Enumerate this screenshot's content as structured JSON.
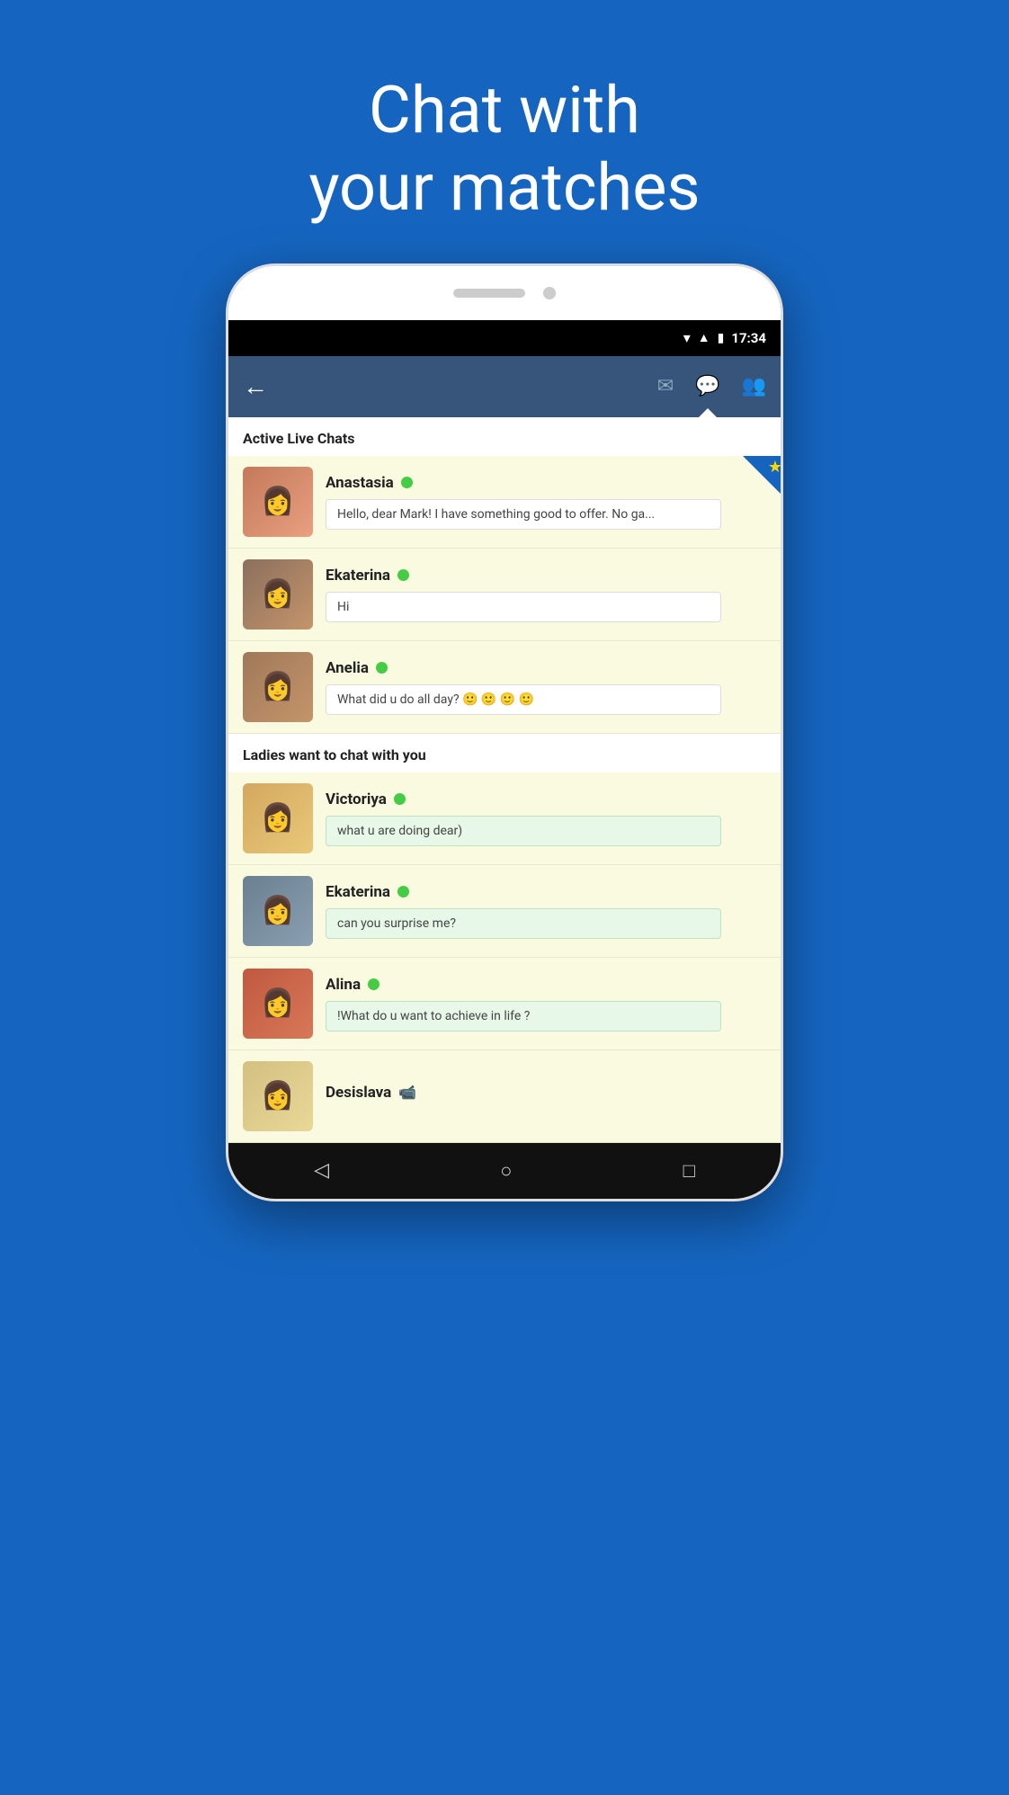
{
  "hero": {
    "line1": "Chat with",
    "line2": "your matches"
  },
  "statusBar": {
    "time": "17:34"
  },
  "header": {
    "backLabel": "←",
    "icons": [
      "mail",
      "chat-bubble",
      "people-list"
    ]
  },
  "activeLivechats": {
    "sectionLabel": "Active Live Chats",
    "items": [
      {
        "name": "Anastasia",
        "online": true,
        "message": "Hello, dear Mark! I have something good to offer. No ga...",
        "avatarClass": "av-anastasia",
        "hasStar": true,
        "mintBg": false
      },
      {
        "name": "Ekaterina",
        "online": true,
        "message": "Hi",
        "avatarClass": "av-ekaterina1",
        "hasStar": false,
        "mintBg": false
      },
      {
        "name": "Anelia",
        "online": true,
        "message": "What did u do all day? 🙂 🙂 🙂 🙂",
        "avatarClass": "av-anelia",
        "hasStar": false,
        "mintBg": false
      }
    ]
  },
  "ladiesSection": {
    "sectionLabel": "Ladies want to chat with you",
    "items": [
      {
        "name": "Victoriya",
        "online": true,
        "message": "what u are doing  dear)",
        "avatarClass": "av-victoriya",
        "hasStar": false,
        "mintBg": true
      },
      {
        "name": "Ekaterina",
        "online": true,
        "message": "can you surprise me?",
        "avatarClass": "av-ekaterina2",
        "hasStar": false,
        "mintBg": true
      },
      {
        "name": "Alina",
        "online": true,
        "message": "!What do u want to achieve in life ?",
        "avatarClass": "av-alina",
        "hasStar": false,
        "mintBg": true
      },
      {
        "name": "Desislava",
        "online": false,
        "hasVideo": true,
        "message": "",
        "avatarClass": "av-desislava",
        "hasStar": false,
        "mintBg": true
      }
    ]
  },
  "navButtons": [
    "◁",
    "○",
    "□"
  ]
}
